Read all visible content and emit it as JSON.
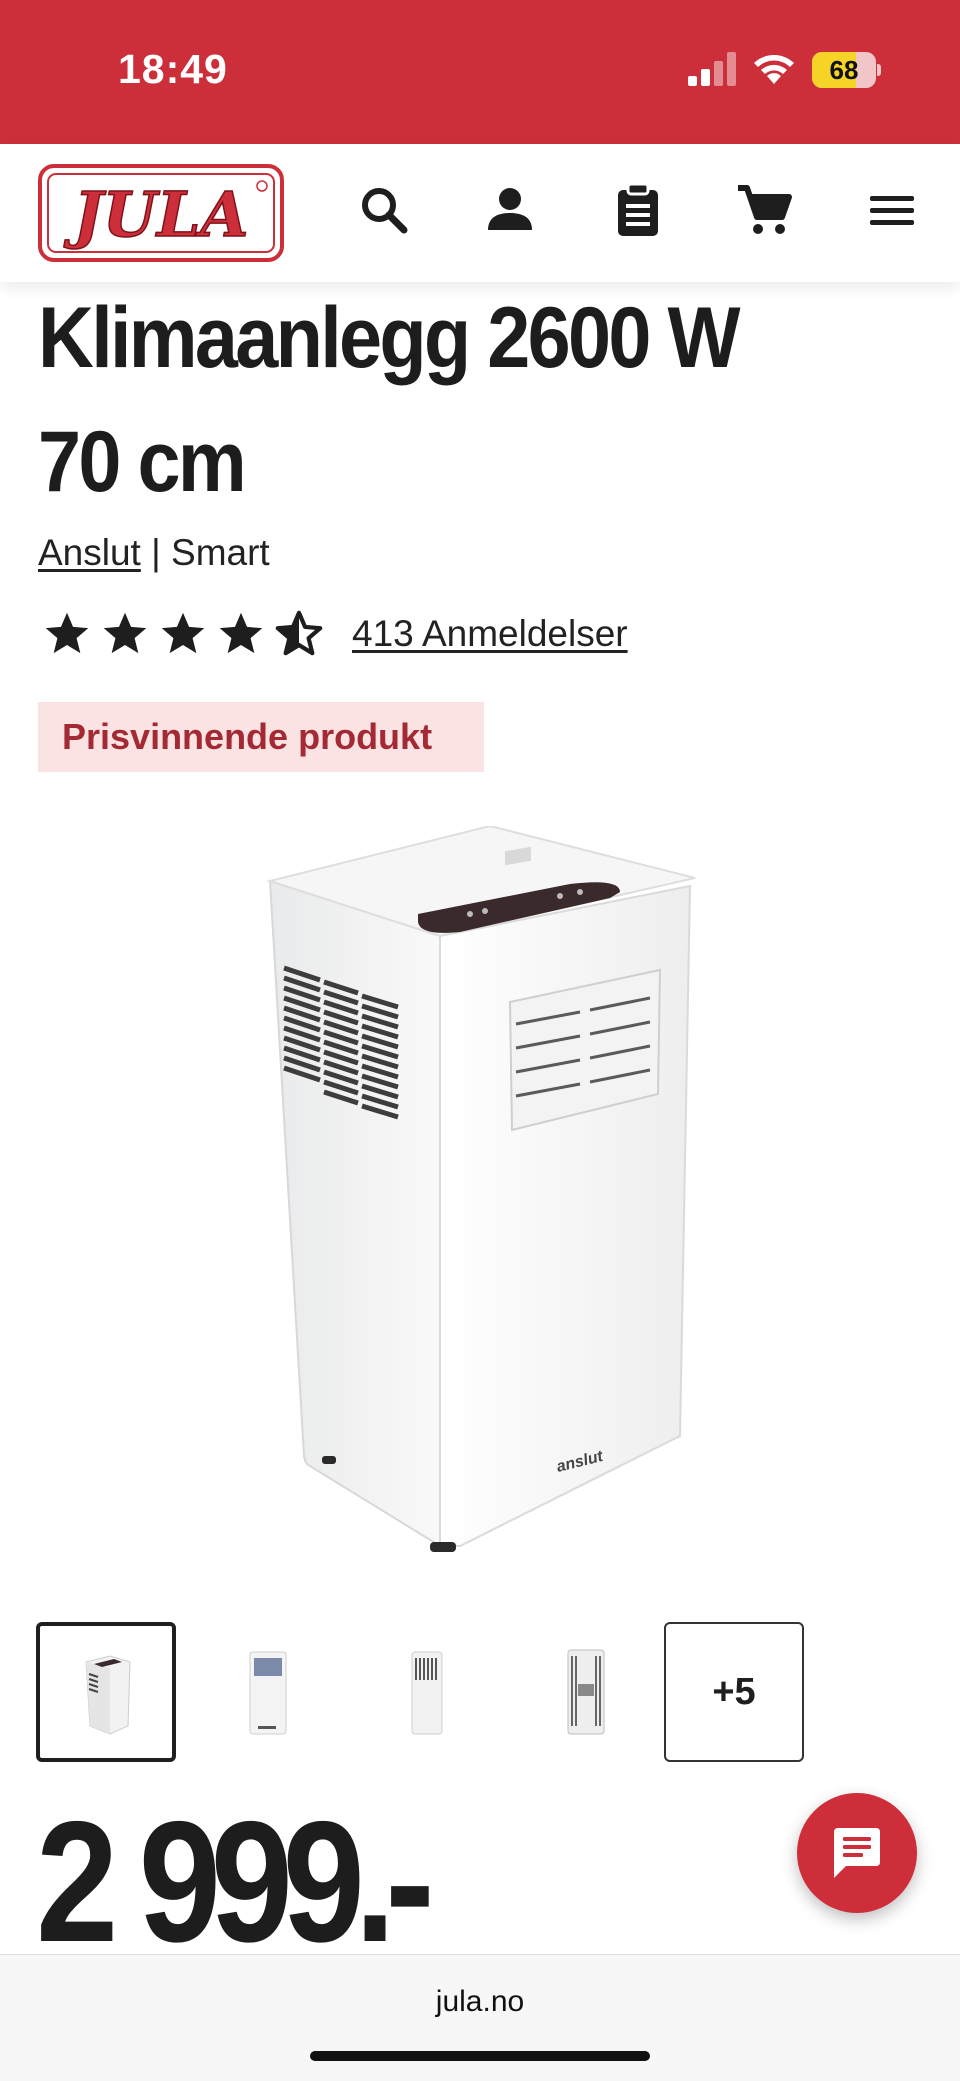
{
  "status_bar": {
    "time": "18:49",
    "battery_level": "68",
    "battery_fraction": 0.68
  },
  "header": {
    "logo_text": "JULA",
    "icons": [
      "search-icon",
      "account-icon",
      "shopping-list-icon",
      "cart-icon",
      "menu-icon"
    ]
  },
  "product": {
    "title": "Klimaanlegg 2600 W 70 cm",
    "brand": "Anslut",
    "separator": " | ",
    "series": "Smart",
    "rating": 4.5,
    "reviews_label": "413 Anmeldelser",
    "badge": "Prisvinnende produkt",
    "product_logo": "anslut",
    "price": "2 999.-"
  },
  "gallery": {
    "more_label": "+5",
    "selected_index": 0
  },
  "browser": {
    "url": "jula.no"
  },
  "colors": {
    "brand_red": "#cc2f3a",
    "badge_bg": "#fbe3e3",
    "badge_text": "#a32a34"
  }
}
